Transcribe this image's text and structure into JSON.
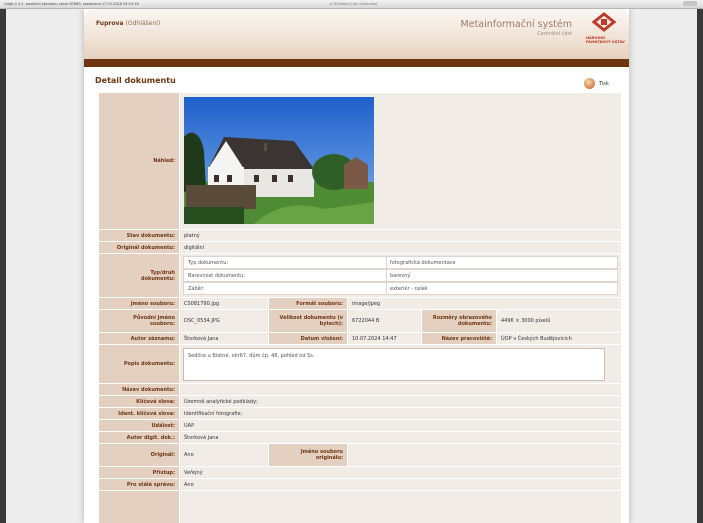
{
  "browser": {
    "left_text": "Grigit 2.4.1. poslední záznamu verze 67889, sestaveno 17.03.2026 04:19:16",
    "center_text": "p Přihlášení [dle účastníka]"
  },
  "header": {
    "user": "Fuprova",
    "logout": "(Odhlášení)",
    "system_title": "Metainformační systém",
    "system_subtitle": "Centrální část",
    "logo_text": "NÁRODNÍ PAMÁTKOVÝ ÚSTAV"
  },
  "page_title": "Detail dokumentu",
  "print_label": "Tisk",
  "fields": {
    "preview_label": "Náhled:",
    "status_label": "Stav dokumentu:",
    "status_value": "platný",
    "original_label": "Originál dokumentu:",
    "original_value": "digitální",
    "type_label": "Typ/druh dokumentu:",
    "type_rows": [
      {
        "k": "Typ dokumentu:",
        "v": "fotografická dokumentace"
      },
      {
        "k": "Barevnost dokumentu:",
        "v": "barevný"
      },
      {
        "k": "Záběr:",
        "v": "exteriér - celek"
      }
    ],
    "filename_label": "Jméno souboru:",
    "filename_value": "CS081790.jpg",
    "format_label": "Formát souboru:",
    "format_value": "image/jpeg",
    "orig_name_label": "Původní jméno souboru:",
    "orig_name_value": "DSC_0534.JPG",
    "size_label": "Velikost dokumentu (v bytech):",
    "size_value": "6722044 B",
    "dims_label": "Rozměry obrazového dokumentu:",
    "dims_value": "4496 × 3000 pixelů",
    "author_label": "Autor záznamu:",
    "author_value": "Štorková Jana",
    "date_label": "Datum vložení:",
    "date_value": "10.07.2024 14:47",
    "workplace_label": "Název pracoviště:",
    "workplace_value": "ÚOP v Českých Budějovicích",
    "desc_label": "Popis dokumentu:",
    "desc_value": "Sedlice u Blatné, okr67, dům čp. 48, pohled od Ss.",
    "name_label": "Název dokumentu:",
    "name_value": "",
    "keywords_label": "Klíčová slova:",
    "keywords_value": "Územně analytické podklady;",
    "ident_label": "Ident. klíčová slova:",
    "ident_value": "Identifikační fotografie;",
    "event_label": "Událost:",
    "event_value": "ÚAP",
    "digi_author_label": "Autor digit. dok.:",
    "digi_author_value": "Štorková Jana",
    "orig2_label": "Originál:",
    "orig2_value": "Ano",
    "orig_file_label": "Jméno souboru originálu:",
    "orig_file_value": "",
    "access_label": "Přístup:",
    "access_value": "Veřejný",
    "permanent_label": "Pro stálé správu:",
    "permanent_value": "Ano"
  },
  "colors": {
    "accent": "#6e3512",
    "label_bg": "#e4d0c1",
    "value_bg": "#f2ece7"
  }
}
